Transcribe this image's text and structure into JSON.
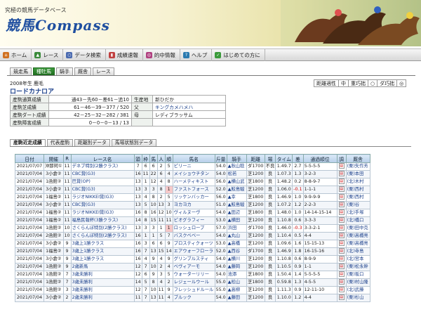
{
  "header": {
    "tagline": "究極の競馬データベース",
    "logo": "競馬Compass"
  },
  "nav": [
    {
      "label": "ホーム",
      "color": "#d07020"
    },
    {
      "label": "レース",
      "color": "#3a8a3a"
    },
    {
      "label": "データ検索",
      "color": "#4a6ab0"
    },
    {
      "label": "成績速報",
      "color": "#c04040"
    },
    {
      "label": "的中情報",
      "color": "#b04080"
    },
    {
      "label": "ヘルプ",
      "color": "#2a7ab0"
    },
    {
      "label": "はじめての方に",
      "color": "#3a9a3a"
    }
  ],
  "subtabs": [
    "競走馬",
    "種牡馬",
    "騎手",
    "厩舎",
    "レース"
  ],
  "horse": {
    "year": "2008年生 鹿毛",
    "name": "ロードカナロア"
  },
  "aptitude": [
    {
      "label": "距離適性"
    },
    {
      "label": "中"
    },
    {
      "label": "重巧拙"
    },
    {
      "label": "○"
    },
    {
      "label": "ダ巧拙"
    },
    {
      "label": "◎"
    }
  ],
  "stats": [
    {
      "label": "産駒通算成績",
      "value": "通43－先60－差61－追10",
      "label2": "生産地",
      "value2": "新ひだか",
      "link": false
    },
    {
      "label": "産駒芝成績",
      "value": "61－46－39－377 / 520",
      "label2": "父",
      "value2": "キングカメハメハ",
      "link": true
    },
    {
      "label": "産駒ダート成績",
      "value": "42－25－32－282 / 381",
      "label2": "母",
      "value2": "レディブラッサム",
      "link": false
    },
    {
      "label": "産駒障害成績",
      "value": "0－0－0－13 / 13",
      "label2": "",
      "value2": "",
      "link": false
    }
  ],
  "content_tabs": [
    "産駒近走成績",
    "代表産駒",
    "距離別データ",
    "馬場状態別データ"
  ],
  "columns": [
    "日付",
    "開催",
    "R",
    "レース名",
    "頭",
    "枠",
    "馬",
    "人",
    "順",
    "馬名",
    "斤量",
    "騎手",
    "距離",
    "場",
    "タイム",
    "差",
    "通過順位",
    "調",
    "厩舎"
  ],
  "rows": [
    [
      "2021/07/07",
      "沖那珂①",
      "11",
      "デネブ特別(2勝クラス)",
      "7",
      "6",
      "6",
      "2",
      "5",
      "ビリーニ",
      "54.0",
      "▲秋山稔",
      "ダ1700",
      "不良",
      "1.49.7",
      "2.7",
      "5-5-5-5",
      "",
      "(栗)矢作芳"
    ],
    [
      "2021/07/04",
      "3小倉②",
      "11",
      "CBC賞(G3)",
      "16",
      "11",
      "22",
      "6",
      "4",
      "メイショウチタン",
      "54.0",
      "松若",
      "芝1200",
      "良",
      "1.07.3",
      "1.3",
      "3-2-3",
      "",
      "(栗)本田"
    ],
    [
      "2021/07/04",
      "1函館②",
      "11",
      "巴賞(OP)",
      "13",
      "1",
      "12",
      "4",
      "8",
      "ハーメティキスト",
      "56.0",
      "▲横山武",
      "芝1800",
      "良",
      "1.48.2",
      "0.2",
      "8-8-9-7",
      "",
      "(北)木村"
    ],
    [
      "2021/07/04",
      "3小倉②",
      "11",
      "CBC賞(G3)",
      "13",
      "3",
      "3",
      "8",
      "1",
      "ファストフォース",
      "52.0",
      "▲鮫島駿",
      "芝1200",
      "良",
      "1.06.0",
      "-0.1",
      "1-1-1",
      "",
      "(栗)西村"
    ],
    [
      "2021/07/04",
      "1福島②",
      "11",
      "ラジオNIKKEI賞(G3)",
      "13",
      "4",
      "8",
      "2",
      "5",
      "リッケンバッカー",
      "56.0",
      "▲幸",
      "芝1800",
      "良",
      "1.46.9",
      "1.0",
      "9-9-9-9",
      "",
      "(栗)西村"
    ],
    [
      "2021/07/04",
      "3小倉②",
      "11",
      "CBC賞(G3)",
      "13",
      "5",
      "10",
      "13",
      "3",
      "ヨカヨカ",
      "51.0",
      "▲鮫島駿",
      "芝1200",
      "良",
      "1.07.2",
      "1.2",
      "2-2-3",
      "",
      "(栗)谷"
    ],
    [
      "2021/07/04",
      "1福島②",
      "11",
      "ラジオNIKKEI賞(G3)",
      "16",
      "8",
      "16",
      "12",
      "10",
      "ヴィルヌーヴ",
      "54.0",
      "▲田辺",
      "芝1800",
      "良",
      "1.48.0",
      "1.0",
      "14-14-15-14",
      "",
      "(北)手塚"
    ],
    [
      "2021/07/04",
      "1福島②",
      "11",
      "福島民報杯(3勝クラス)",
      "14",
      "8",
      "15",
      "11",
      "11",
      "ビオグラフィー",
      "53.0",
      "▲横田",
      "芝1200",
      "良",
      "1.10.8",
      "0.6",
      "3-3-3",
      "",
      "(北)橋口"
    ],
    [
      "2021/07/04",
      "1函館②",
      "10",
      "さくらんぼ特別(2勝クラス)",
      "13",
      "3",
      "3",
      "1",
      "1",
      "ロッシュロープ",
      "57.0",
      "浜田",
      "ダ1700",
      "良",
      "1.46.0",
      "-0.3",
      "3-3-2-1",
      "",
      "(栗)田中克"
    ],
    [
      "2021/07/04",
      "2函館②",
      "10",
      "さくらんぼ特別(2勝クラス)",
      "16",
      "1",
      "1",
      "5",
      "7",
      "バスクベベー",
      "54.0",
      "▲丸山",
      "芝1200",
      "良",
      "1.10.4",
      "0.5",
      "4-4",
      "",
      "(栗)高橋亮"
    ],
    [
      "2021/07/04",
      "3小倉②",
      "9",
      "3歳上1勝クラス",
      "16",
      "3",
      "6",
      "6",
      "9",
      "プロスティクォーツ",
      "53.0",
      "▲高橋",
      "芝1200",
      "良",
      "1.09.6",
      "1.6",
      "15-15-13",
      "",
      "(栗)高橋亮"
    ],
    [
      "2021/07/04",
      "1福島②",
      "9",
      "3歳上1勝クラス",
      "16",
      "7",
      "13",
      "15",
      "14",
      "エアウォーフローラ",
      "52.0",
      "▲西谷",
      "ダ1700",
      "良",
      "1.46.9",
      "1.8",
      "16-15-16",
      "",
      "(北)寺島"
    ],
    [
      "2021/07/04",
      "3小倉②",
      "9",
      "3歳上1勝クラス",
      "16",
      "4",
      "9",
      "4",
      "9",
      "グリンブルスティ",
      "54.0",
      "▲横川",
      "芝1200",
      "良",
      "1.10.8",
      "0.6",
      "8-9-9",
      "",
      "(北)宮本"
    ],
    [
      "2021/07/04",
      "1函館②",
      "9",
      "2歳新馬",
      "12",
      "7",
      "10",
      "2",
      "4",
      "ベヴィアーモ",
      "54.0",
      "▲藤岡",
      "芝1200",
      "良",
      "1.10.5",
      "0.9",
      "1-1",
      "",
      "(栗)松永幹"
    ],
    [
      "2021/07/04",
      "1函館②",
      "7",
      "3歳未勝利",
      "12",
      "6",
      "9",
      "3",
      "5",
      "ウォーターリリー",
      "54.0",
      "池添",
      "芝1800",
      "良",
      "1.50.4",
      "1.4",
      "5-5-5-5",
      "",
      "(栗)坂口"
    ],
    [
      "2021/07/04",
      "1函館②",
      "7",
      "3歳未勝利",
      "14",
      "5",
      "8",
      "4",
      "2",
      "レジェールウール",
      "55.0",
      "▲松山",
      "芝1800",
      "良",
      "0.59.8",
      "1.3",
      "4-5-5",
      "",
      "(栗)村山隆"
    ],
    [
      "2021/07/04",
      "1函館②",
      "3",
      "3歳未勝利",
      "12",
      "7",
      "10",
      "11",
      "9",
      "フレッシュドルール",
      "55.0",
      "▲高柳",
      "芝1200",
      "良",
      "1.11.3",
      "0.9",
      "12-11-10",
      "",
      "(北)武藤"
    ],
    [
      "2021/07/04",
      "3小倉②",
      "2",
      "2歳未勝利",
      "11",
      "7",
      "13",
      "11",
      "4",
      "ブルック",
      "54.0",
      "▲藤田",
      "芝1200",
      "良",
      "1.10.0",
      "1.2",
      "4-4",
      "",
      "(栗)杉山"
    ]
  ]
}
